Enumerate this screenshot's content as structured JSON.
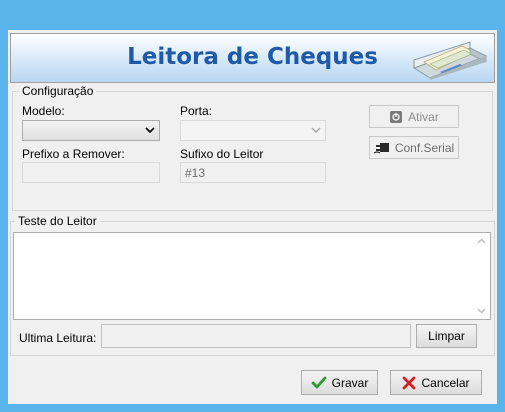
{
  "banner": {
    "title": "Leitora de Cheques",
    "image": "check-reader-device-icon"
  },
  "config": {
    "legend": "Configuração",
    "modelo_label": "Modelo:",
    "modelo_value": "",
    "porta_label": "Porta:",
    "porta_value": "",
    "prefixo_label": "Prefixo a Remover:",
    "prefixo_value": "",
    "sufixo_label": "Sufixo do Leitor",
    "sufixo_value": "#13",
    "ativar_label": "Ativar",
    "conf_serial_label": "Conf.Serial"
  },
  "teste": {
    "legend": "Teste do Leitor",
    "memo_value": "",
    "ultima_label": "Ultima Leitura:",
    "ultima_value": "",
    "limpar_label": "Limpar"
  },
  "footer": {
    "gravar_label": "Gravar",
    "cancelar_label": "Cancelar"
  },
  "colors": {
    "window_frame": "#5ab4ec",
    "title_text": "#1e5aa8",
    "ok_green": "#2e9b2e",
    "cancel_red": "#d02020"
  }
}
